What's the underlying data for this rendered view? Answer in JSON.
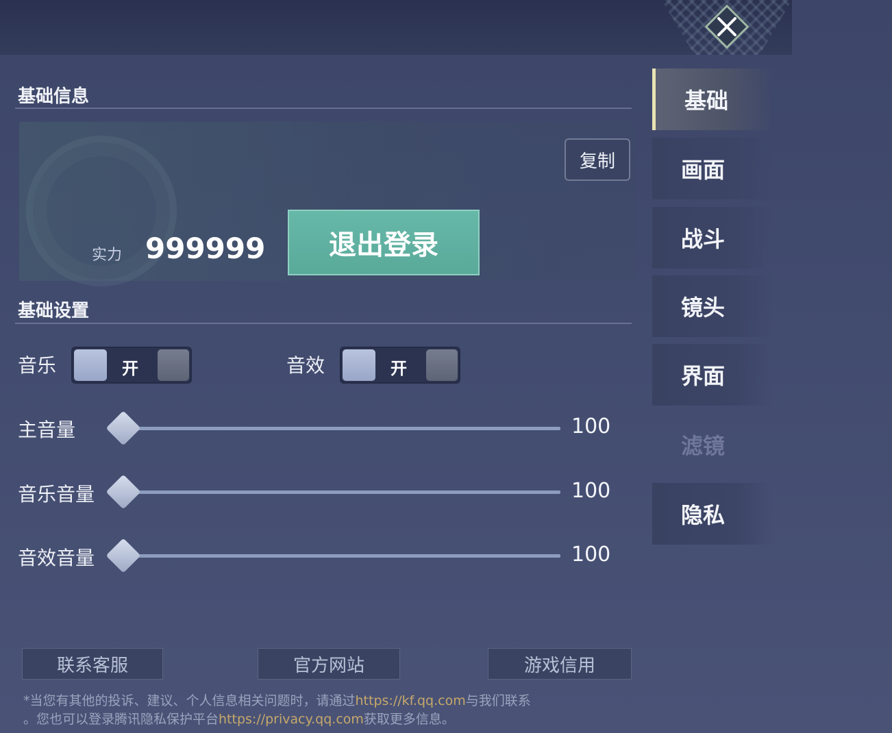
{
  "header": {
    "close_icon": "close-x-icon"
  },
  "basic_info": {
    "title": "基础信息",
    "copy_label": "复制",
    "power_label": "实力",
    "power_value": "999999",
    "logout_label": "退出登录"
  },
  "basic_settings": {
    "title": "基础设置",
    "toggles": [
      {
        "label": "音乐",
        "state": "开",
        "on": true
      },
      {
        "label": "音效",
        "state": "开",
        "on": true
      }
    ],
    "sliders": [
      {
        "label": "主音量",
        "value": "100",
        "level": 0
      },
      {
        "label": "音乐音量",
        "value": "100",
        "level": 0
      },
      {
        "label": "音效音量",
        "value": "100",
        "level": 0
      }
    ]
  },
  "footer": {
    "buttons": [
      "联系客服",
      "官方网站",
      "游戏信用"
    ],
    "notice": {
      "line1_pre": "*当您有其他的投诉、建议、个人信息相关问题时，请通过",
      "line1_link": "https://kf.qq.com",
      "line1_post": "与我们联系",
      "line2_pre": "。您也可以登录腾讯隐私保护平台",
      "line2_link": "https://privacy.qq.com",
      "line2_post": "获取更多信息。"
    }
  },
  "sidebar": {
    "tabs": [
      {
        "label": "基础",
        "active": true
      },
      {
        "label": "画面"
      },
      {
        "label": "战斗"
      },
      {
        "label": "镜头"
      },
      {
        "label": "界面"
      },
      {
        "label": "滤镜",
        "disabled": true
      },
      {
        "label": "隐私"
      }
    ]
  },
  "colors": {
    "accent_teal": "#5aaa9a",
    "link_gold": "#c7a86a",
    "active_tab_border": "#e9e3b4"
  }
}
